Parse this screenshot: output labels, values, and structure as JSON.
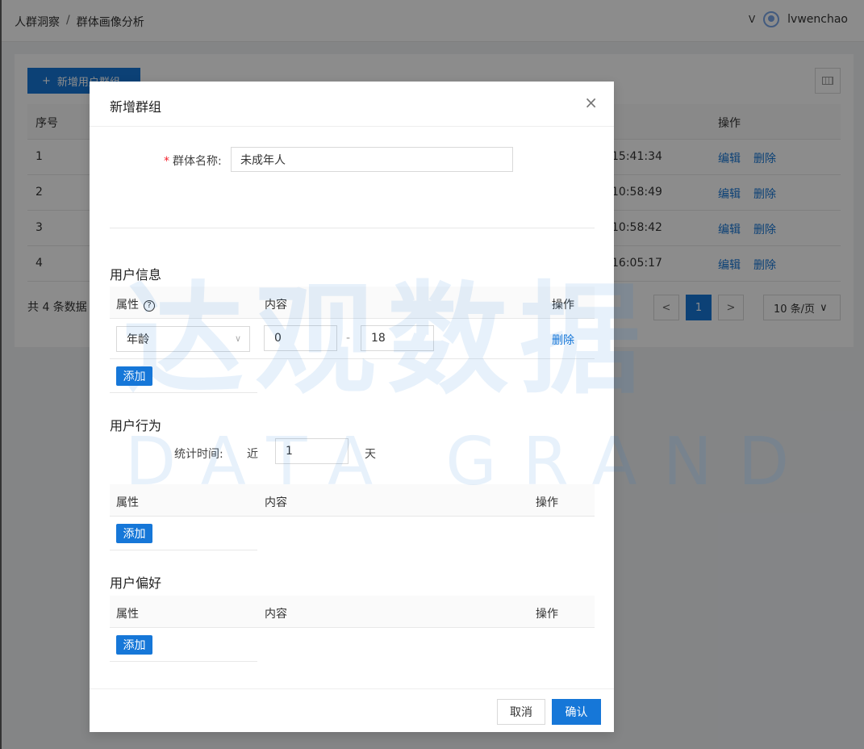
{
  "header": {
    "breadcrumb": [
      "人群洞察",
      "群体画像分析"
    ],
    "breadcrumb_sep": "/",
    "dropdown_glyph": "V",
    "username": "lvwenchao"
  },
  "background": {
    "add_group_button": "新增用户群组",
    "table_header": {
      "index": "序号",
      "ops": "操作"
    },
    "rows": [
      {
        "index": "1",
        "time": "15:41:34",
        "edit": "编辑",
        "delete": "删除"
      },
      {
        "index": "2",
        "time": "10:58:49",
        "edit": "编辑",
        "delete": "删除"
      },
      {
        "index": "3",
        "time": "10:58:42",
        "edit": "编辑",
        "delete": "删除"
      },
      {
        "index": "4",
        "time": "16:05:17",
        "edit": "编辑",
        "delete": "删除"
      }
    ],
    "total_text": "共 4 条数据",
    "pagination": {
      "prev": "<",
      "current": "1",
      "next": ">",
      "page_size": "10 条/页"
    }
  },
  "modal": {
    "title": "新增群组",
    "close": "×",
    "name_field": {
      "label": "群体名称:",
      "value": "未成年人"
    },
    "user_info": {
      "title": "用户信息",
      "col_attr": "属性",
      "col_content": "内容",
      "col_ops": "操作",
      "row": {
        "attr": "年龄",
        "min": "0",
        "sep": "-",
        "max": "18",
        "delete": "删除"
      },
      "add": "添加"
    },
    "user_behavior": {
      "title": "用户行为",
      "stat_label": "统计时间:",
      "near": "近",
      "days": "1",
      "day_unit": "天",
      "col_attr": "属性",
      "col_content": "内容",
      "col_ops": "操作",
      "add": "添加"
    },
    "user_pref": {
      "title": "用户偏好",
      "col_attr": "属性",
      "col_content": "内容",
      "col_ops": "操作",
      "add": "添加"
    },
    "cancel": "取消",
    "confirm": "确认"
  },
  "watermark": {
    "cn": "达观数据",
    "en": "DATA GRAND"
  },
  "colors": {
    "primary": "#1677d8",
    "required": "#f5222d"
  }
}
